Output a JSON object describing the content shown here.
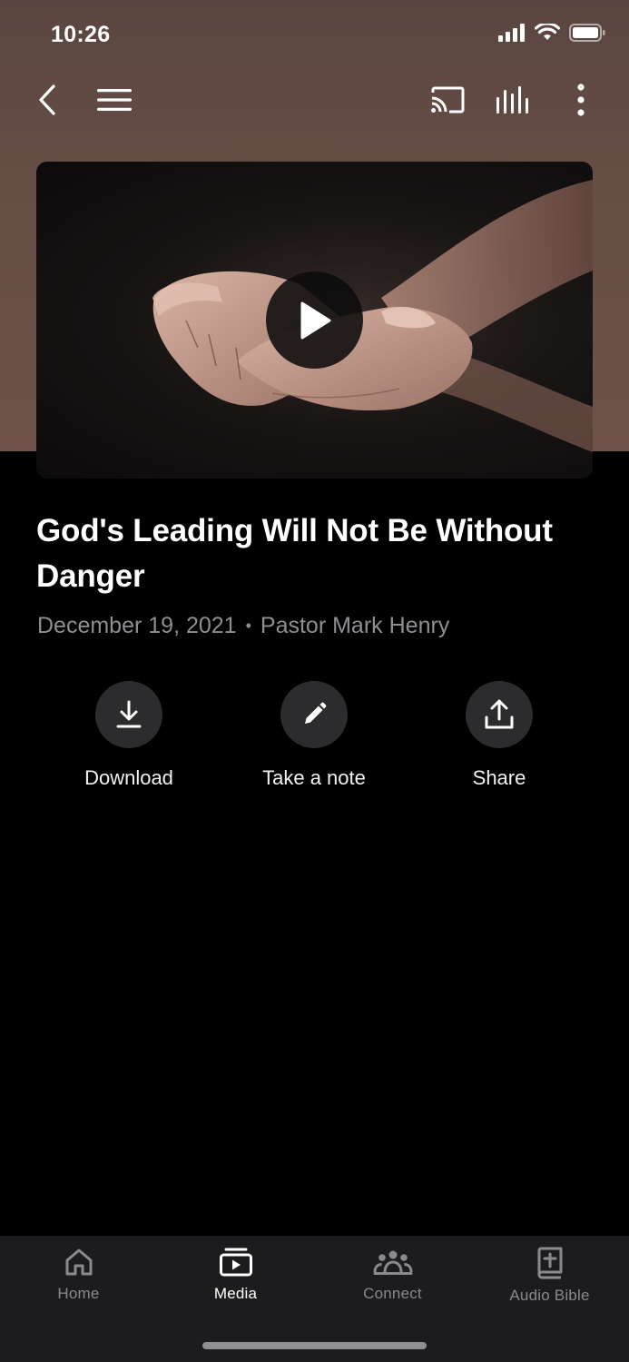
{
  "status_bar": {
    "time": "10:26",
    "icons": [
      "signal-icon",
      "wifi-icon",
      "battery-icon"
    ]
  },
  "nav": {
    "icons": [
      "back-chevron-icon",
      "menu-icon",
      "cast-icon",
      "audio-bars-icon",
      "more-vertical-icon"
    ]
  },
  "media": {
    "title": "God's Leading Will Not Be Without Danger",
    "date": "December 19, 2021",
    "separator": "•",
    "speaker": "Pastor Mark Henry",
    "play_icon": "play-icon"
  },
  "actions": [
    {
      "label": "Download",
      "icon": "download-icon"
    },
    {
      "label": "Take a note",
      "icon": "pencil-icon"
    },
    {
      "label": "Share",
      "icon": "share-icon"
    }
  ],
  "tab_bar": {
    "tabs": [
      {
        "label": "Home",
        "icon": "home-icon",
        "active": false
      },
      {
        "label": "Media",
        "icon": "media-icon",
        "active": true
      },
      {
        "label": "Connect",
        "icon": "people-icon",
        "active": false
      },
      {
        "label": "Audio Bible",
        "icon": "bible-icon",
        "active": false
      }
    ]
  },
  "colors": {
    "hero_background": "#664e46",
    "page_background": "#000000",
    "tab_bar_background": "#1c1c1e",
    "action_circle": "#2c2c2e",
    "secondary_text": "#8e8e93"
  }
}
